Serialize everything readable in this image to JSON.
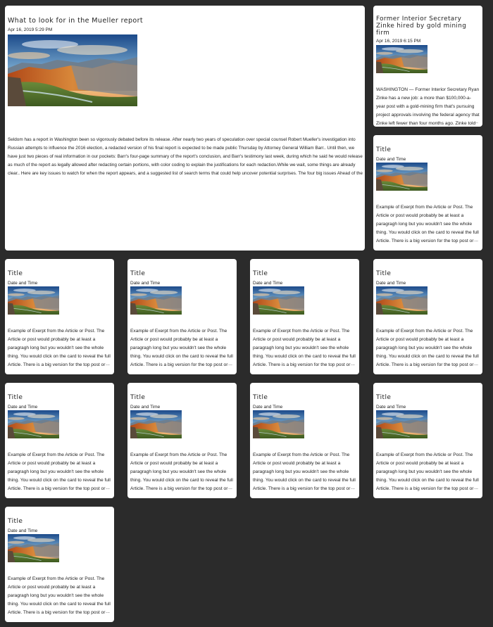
{
  "featured": {
    "title": "What to look for in the Mueller report",
    "date": "Apr 16, 2019 5:29 PM",
    "excerpt": "Seldom has a report in Washington been so vigorously debated before its release. After nearly two years of speculation over special counsel Robert Mueller's investigation into Russian attempts to influence the 2016 election, a redacted version of his final report is expected to be made public Thursday by Attorney General William Barr.. Until then, we have just two pieces of real information in our pockets: Barr's four-page summary of the report's conclusion, and Barr's testimony last week, during which he said he would release as much of the report as legally allowed after redacting certain portions, with color coding to explain the justifications for each redaction.While we wait, some things are already clear.. Here are key issues to watch for when the report appears, and a suggested list of search terms that could help uncover potential surprises. The four big issues Ahead of the report, four issues loom.."
  },
  "side_top": {
    "title": "Former Interior Secretary Zinke hired by gold mining firm",
    "date": "Apr 16, 2019 6:15 PM",
    "excerpt": "WASHINGTON — Former Interior Secretary Ryan Zinke has a new job: a more than $100,000-a-year post with a gold-mining firm that's pursuing project approvals involving the federal agency that Zinke left fewer than four months ago. Zinke told The",
    "more": "..."
  },
  "placeholder": {
    "title": "Title",
    "date": "Date and Time",
    "excerpt": "Example of Exerpt from the Article or Post. The Article or post would probably be at least a paragragh long but you wouldn't see the whole thing. You would click on the card to reveal the full Article. There is a big version for the top post or breaking",
    "more": "..."
  },
  "colors": {
    "background": "#2b2b2b",
    "card": "#ffffff"
  }
}
